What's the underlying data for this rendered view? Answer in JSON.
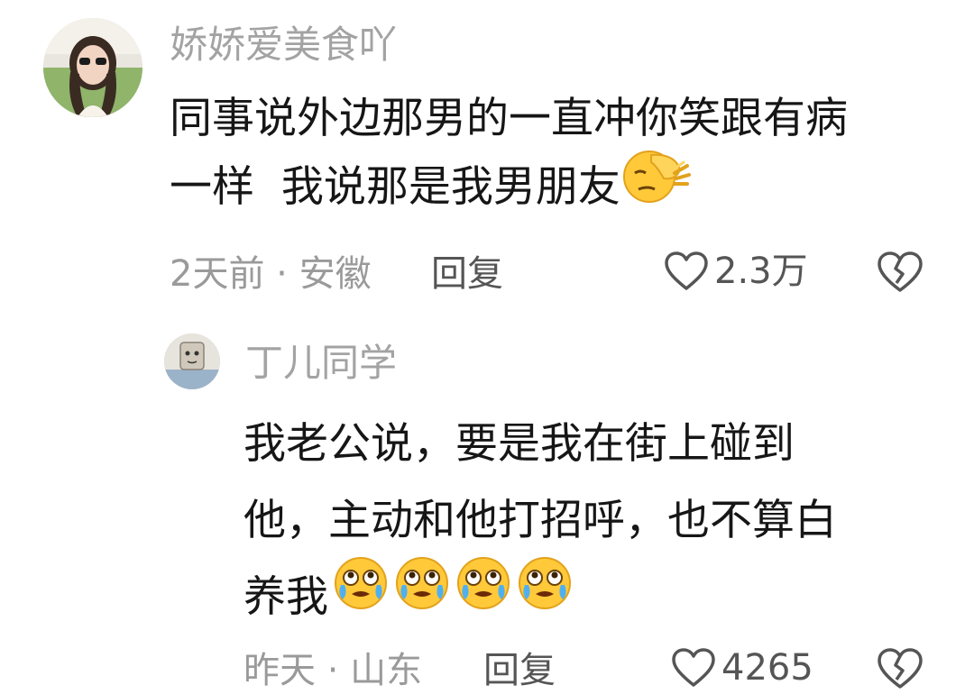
{
  "comments": [
    {
      "username": "娇娇爱美食吖",
      "text_line1": "同事说外边那男的一直冲你笑跟有病",
      "text_line2": "一样  我说那是我男朋友",
      "emoji": "face-palm",
      "meta": "2天前 · 安徽",
      "reply_label": "回复",
      "like_count": "2.3万"
    }
  ],
  "replies": [
    {
      "username": "丁儿同学",
      "text_line1": "我老公说，要是我在街上碰到",
      "text_line2": "他，主动和他打招呼，也不算白",
      "text_line3": "养我",
      "emojis": [
        "crying-face",
        "crying-face",
        "crying-face",
        "crying-face"
      ],
      "meta": "昨天 · 山东",
      "reply_label": "回复",
      "like_count": "4265"
    }
  ],
  "icons": {
    "like": "heart-outline-icon",
    "dislike": "broken-heart-icon"
  },
  "colors": {
    "username": "#a3a3a3",
    "text": "#161616",
    "meta": "#9a9a9a",
    "action": "#555555",
    "emoji_yellow": "#ffc93a"
  }
}
